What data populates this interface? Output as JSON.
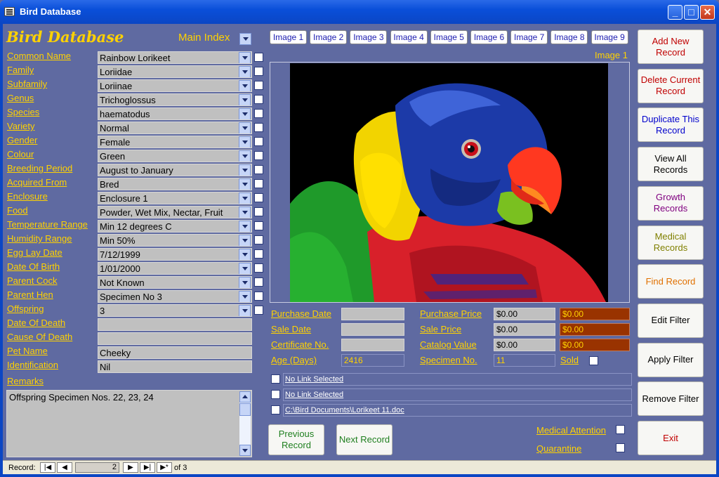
{
  "window": {
    "title": "Bird Database"
  },
  "header": {
    "heading": "Bird Database",
    "main_index_label": "Main Index"
  },
  "fields": [
    {
      "label": "Common Name",
      "value": "Rainbow Lorikeet"
    },
    {
      "label": "Family",
      "value": "Loriidae"
    },
    {
      "label": "Subfamily",
      "value": "Loriinae"
    },
    {
      "label": "Genus",
      "value": "Trichoglossus"
    },
    {
      "label": "Species",
      "value": "haematodus"
    },
    {
      "label": "Variety",
      "value": "Normal"
    },
    {
      "label": "Gender",
      "value": "Female"
    },
    {
      "label": "Colour",
      "value": "Green"
    },
    {
      "label": "Breeding Period",
      "value": "August to January"
    },
    {
      "label": "Acquired From",
      "value": "Bred"
    },
    {
      "label": "Enclosure",
      "value": "Enclosure 1"
    },
    {
      "label": "Food ",
      "value": "Powder, Wet Mix, Nectar, Fruit"
    },
    {
      "label": "Temperature Range",
      "value": "Min 12 degrees C"
    },
    {
      "label": "Humidity Range",
      "value": "Min 50%"
    },
    {
      "label": "Egg Lay Date",
      "value": "7/12/1999"
    },
    {
      "label": "Date Of Birth",
      "value": "1/01/2000"
    },
    {
      "label": "Parent Cock",
      "value": "Not Known"
    },
    {
      "label": "Parent Hen",
      "value": "Specimen No 3"
    },
    {
      "label": "Offspring",
      "value": "3"
    },
    {
      "label": "Date Of Death",
      "value": ""
    },
    {
      "label": "Cause Of Death",
      "value": ""
    },
    {
      "label": "Pet Name",
      "value": "Cheeky"
    },
    {
      "label": "Identification",
      "value": "Nil"
    }
  ],
  "remarks": {
    "label": "Remarks",
    "value": "Offspring Specimen Nos. 22, 23, 24"
  },
  "image_tabs": [
    "Image 1",
    "Image 2",
    "Image 3",
    "Image 4",
    "Image 5",
    "Image 6",
    "Image 7",
    "Image 8",
    "Image 9"
  ],
  "image_caption": "Image 1",
  "details": {
    "purchase_date_label": "Purchase Date",
    "purchase_date": "",
    "sale_date_label": "Sale Date",
    "sale_date": "",
    "certificate_label": "Certificate No.",
    "certificate": "",
    "age_label": "Age (Days)",
    "age": "2416",
    "purchase_price_label": "Purchase Price",
    "purchase_price": "$0.00",
    "purchase_price_alt": "$0.00",
    "sale_price_label": "Sale Price",
    "sale_price": "$0.00",
    "sale_price_alt": "$0.00",
    "catalog_value_label": "Catalog Value",
    "catalog_value": "$0.00",
    "catalog_value_alt": "$0.00",
    "specimen_label": "Specimen No.",
    "specimen": "11",
    "sold_label": "Sold"
  },
  "links": [
    "No Link Selected",
    "No Link Selected",
    "C:\\Bird Documents\\Lorikeet 11.doc"
  ],
  "flags": {
    "medical_attention": "Medical Attention",
    "quarantine": "Quarantine"
  },
  "nav": {
    "previous": "Previous Record",
    "next": "Next Record"
  },
  "side_buttons": [
    {
      "label": "Add New Record",
      "color": "#c00000"
    },
    {
      "label": "Delete Current Record",
      "color": "#c00000"
    },
    {
      "label": "Duplicate This Record",
      "color": "#0000cc"
    },
    {
      "label": "View All Records",
      "color": "#000000"
    },
    {
      "label": "Growth Records",
      "color": "#800080"
    },
    {
      "label": "Medical Records",
      "color": "#808000"
    },
    {
      "label": "Find Record",
      "color": "#e07000"
    },
    {
      "label": "Edit Filter",
      "color": "#000000"
    },
    {
      "label": "Apply Filter",
      "color": "#000000"
    },
    {
      "label": "Remove Filter",
      "color": "#000000"
    },
    {
      "label": "Exit",
      "color": "#c00000"
    }
  ],
  "statusbar": {
    "record_label": "Record:",
    "current": "2",
    "of_text": "of  3"
  }
}
